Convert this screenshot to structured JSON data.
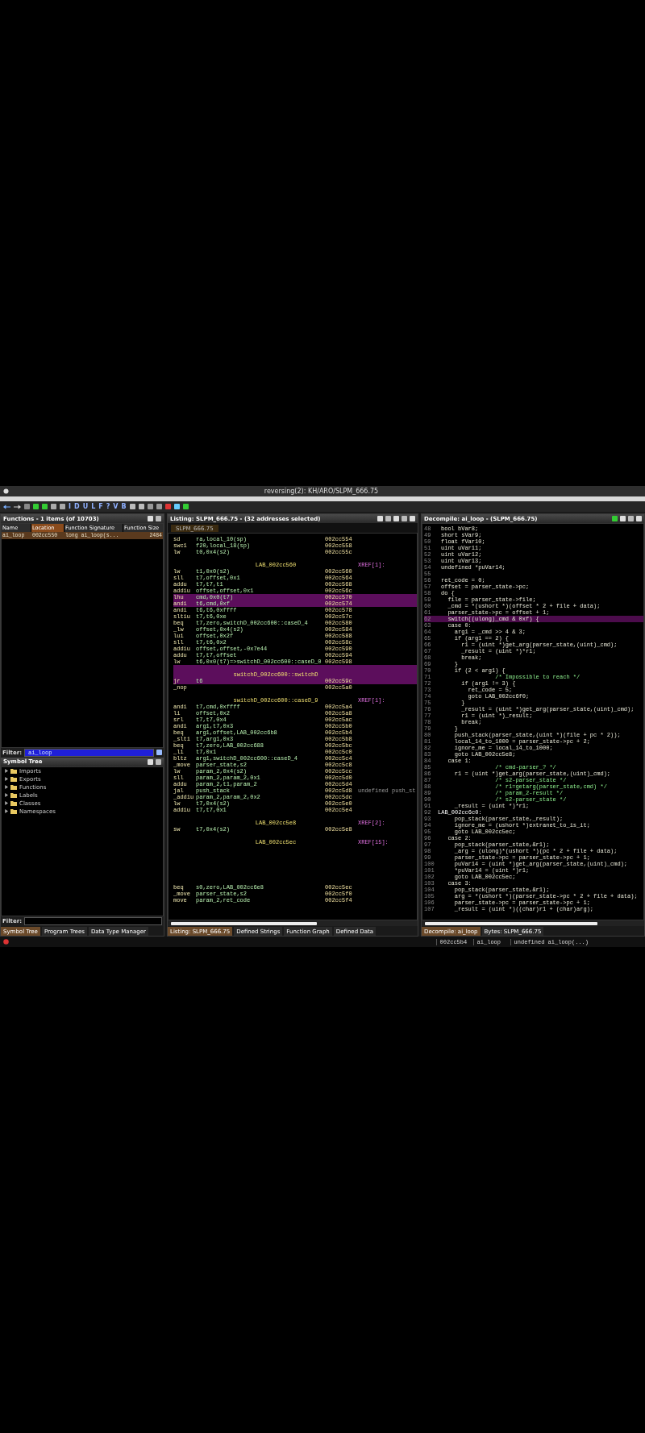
{
  "window": {
    "title": "reversing(2): KH/ARO/SLPM_666.75"
  },
  "toolbar": {
    "letters": [
      "I",
      "D",
      "U",
      "L",
      "F",
      "?",
      "V",
      "B"
    ]
  },
  "functions": {
    "title": "Functions - 1 items (of 10703)",
    "columns": [
      {
        "label": "Name",
        "sorted": false
      },
      {
        "label": "Location",
        "sorted": true
      },
      {
        "label": "Function Signature",
        "sorted": false
      },
      {
        "label": "Function Size",
        "sorted": false
      }
    ],
    "rows": [
      {
        "cells": [
          "ai_loop",
          "002cc550",
          "long ai_loop(s...",
          "2484"
        ],
        "selected": true
      }
    ],
    "filter_label": "Filter:",
    "filter": "ai_loop"
  },
  "symbol_tree": {
    "title": "Symbol Tree",
    "items": [
      {
        "label": "Imports",
        "expanded": false
      },
      {
        "label": "Exports",
        "expanded": false
      },
      {
        "label": "Functions",
        "expanded": false
      },
      {
        "label": "Labels",
        "expanded": false
      },
      {
        "label": "Classes",
        "expanded": false
      },
      {
        "label": "Namespaces",
        "expanded": false
      }
    ],
    "filter_label": "Filter:"
  },
  "left_tabs": [
    {
      "label": "Symbol Tree",
      "selected": true
    },
    {
      "label": "Program Trees",
      "selected": false
    },
    {
      "label": "Data Type Manager",
      "selected": false
    }
  ],
  "listing": {
    "title": "Listing:  SLPM_666.75 - (32 addresses selected)",
    "tab": "SLPM_666.75",
    "rows": [
      {
        "kind": "instr",
        "mnemonic": "sd",
        "operands": "ra,local_10(sp)",
        "address": "002cc554",
        "selected": false
      },
      {
        "kind": "instr",
        "mnemonic": "swc1",
        "operands": "f20,local_18(sp)",
        "address": "002cc558",
        "selected": false
      },
      {
        "kind": "instr",
        "mnemonic": "lw",
        "operands": "t0,0x4(s2)",
        "address": "002cc55c",
        "selected": false
      },
      {
        "kind": "blank",
        "selected": false
      },
      {
        "kind": "label",
        "label": "LAB_002cc560",
        "xref": "XREF[1]:",
        "selected": false
      },
      {
        "kind": "instr",
        "mnemonic": "lw",
        "operands": "t1,0x0(s2)",
        "address": "002cc560",
        "selected": false
      },
      {
        "kind": "instr",
        "mnemonic": "sll",
        "operands": "t7,offset,0x1",
        "address": "002cc564",
        "selected": false
      },
      {
        "kind": "instr",
        "mnemonic": "addu",
        "operands": "t7,t7,t1",
        "address": "002cc568",
        "selected": false
      },
      {
        "kind": "instr",
        "mnemonic": "addiu",
        "operands": "offset,offset,0x1",
        "address": "002cc56c",
        "selected": false
      },
      {
        "kind": "instr",
        "mnemonic": "lhu",
        "operands": "cmd,0x0(t7)",
        "address": "002cc570",
        "selected": true
      },
      {
        "kind": "instr",
        "mnemonic": "andi",
        "operands": "t6,cmd,0xf",
        "address": "002cc574",
        "selected": true
      },
      {
        "kind": "instr",
        "mnemonic": "andi",
        "operands": "t6,t6,0xffff",
        "address": "002cc578",
        "selected": false
      },
      {
        "kind": "instr",
        "mnemonic": "sltiu",
        "operands": "t7,t6,0xe",
        "address": "002cc57c",
        "selected": false
      },
      {
        "kind": "instr",
        "mnemonic": "beq",
        "operands": "t7,zero,switchD_002cc600::caseD_4",
        "address": "002cc580",
        "selected": false
      },
      {
        "kind": "instr",
        "mnemonic": "_lw",
        "operands": "offset,0x4(s2)",
        "address": "002cc584",
        "selected": false
      },
      {
        "kind": "instr",
        "mnemonic": "lui",
        "operands": "offset,0x2f",
        "address": "002cc588",
        "selected": false
      },
      {
        "kind": "instr",
        "mnemonic": "sll",
        "operands": "t7,t6,0x2",
        "address": "002cc58c",
        "selected": false
      },
      {
        "kind": "instr",
        "mnemonic": "addiu",
        "operands": "offset,offset,-0x7e44",
        "address": "002cc590",
        "selected": false
      },
      {
        "kind": "instr",
        "mnemonic": "addu",
        "operands": "t7,t7,offset",
        "address": "002cc594",
        "selected": false
      },
      {
        "kind": "instr",
        "mnemonic": "lw",
        "operands": "t6,0x0(t7)=>switchD_002cc600::caseD_0",
        "address": "002cc598",
        "selected": false
      },
      {
        "kind": "blank",
        "selected": true
      },
      {
        "kind": "label",
        "label": "switchD_002cc600::switchD",
        "selected": true
      },
      {
        "kind": "instr",
        "mnemonic": "jr",
        "operands": "t6",
        "address": "002cc59c",
        "selected": true
      },
      {
        "kind": "instr",
        "mnemonic": "_nop",
        "operands": "",
        "address": "002cc5a0",
        "selected": false
      },
      {
        "kind": "blank",
        "selected": false
      },
      {
        "kind": "label",
        "label": "switchD_002cc600::caseD_9",
        "xref": "XREF[1]:",
        "selected": false
      },
      {
        "kind": "instr",
        "mnemonic": "andi",
        "operands": "t7,cmd,0xffff",
        "address": "002cc5a4",
        "selected": false
      },
      {
        "kind": "instr",
        "mnemonic": "li",
        "operands": "offset,0x2",
        "address": "002cc5a8",
        "selected": false
      },
      {
        "kind": "instr",
        "mnemonic": "srl",
        "operands": "t7,t7,0x4",
        "address": "002cc5ac",
        "selected": false
      },
      {
        "kind": "instr",
        "mnemonic": "andi",
        "operands": "arg1,t7,0x3",
        "address": "002cc5b0",
        "selected": false
      },
      {
        "kind": "instr",
        "mnemonic": "beq",
        "operands": "arg1,offset,LAB_002cc6b8",
        "address": "002cc5b4",
        "selected": false
      },
      {
        "kind": "instr",
        "mnemonic": "_slti",
        "operands": "t7,arg1,0x3",
        "address": "002cc5b8",
        "selected": false
      },
      {
        "kind": "instr",
        "mnemonic": "beq",
        "operands": "t7,zero,LAB_002cc688",
        "address": "002cc5bc",
        "selected": false
      },
      {
        "kind": "instr",
        "mnemonic": "_li",
        "operands": "t7,0x1",
        "address": "002cc5c0",
        "selected": false
      },
      {
        "kind": "instr",
        "mnemonic": "bltz",
        "operands": "arg1,switchD_002cc600::caseD_4",
        "address": "002cc5c4",
        "selected": false
      },
      {
        "kind": "instr",
        "mnemonic": "_move",
        "operands": "parser_state,s2",
        "address": "002cc5c8",
        "selected": false
      },
      {
        "kind": "instr",
        "mnemonic": "lw",
        "operands": "param_2,0x4(s2)",
        "address": "002cc5cc",
        "selected": false
      },
      {
        "kind": "instr",
        "mnemonic": "sll",
        "operands": "param_2,param_2,0x1",
        "address": "002cc5d0",
        "selected": false
      },
      {
        "kind": "instr",
        "mnemonic": "addu",
        "operands": "param_2,t1,param_2",
        "address": "002cc5d4",
        "selected": false
      },
      {
        "kind": "instr",
        "mnemonic": "jal",
        "operands": "push_stack",
        "address": "002cc5d8",
        "comment": "undefined push_st",
        "selected": false
      },
      {
        "kind": "instr",
        "mnemonic": "_addiu",
        "operands": "param_2,param_2,0x2",
        "address": "002cc5dc",
        "selected": false
      },
      {
        "kind": "instr",
        "mnemonic": "lw",
        "operands": "t7,0x4(s2)",
        "address": "002cc5e0",
        "selected": false
      },
      {
        "kind": "instr",
        "mnemonic": "addiu",
        "operands": "t7,t7,0x1",
        "address": "002cc5e4",
        "selected": false
      },
      {
        "kind": "blank",
        "selected": false
      },
      {
        "kind": "label",
        "label": "LAB_002cc5e8",
        "xref": "XREF[2]:",
        "selected": false
      },
      {
        "kind": "instr",
        "mnemonic": "sw",
        "operands": "t7,0x4(s2)",
        "address": "002cc5e8",
        "selected": false
      },
      {
        "kind": "blank",
        "selected": false
      },
      {
        "kind": "label",
        "label": "LAB_002cc5ec",
        "xref": "XREF[15]:",
        "selected": false
      },
      {
        "kind": "blank",
        "selected": false
      },
      {
        "kind": "blank",
        "selected": false
      },
      {
        "kind": "blank",
        "selected": false
      },
      {
        "kind": "blank",
        "selected": false
      },
      {
        "kind": "blank",
        "selected": false
      },
      {
        "kind": "blank",
        "selected": false
      },
      {
        "kind": "instr",
        "mnemonic": "beq",
        "operands": "s0,zero,LAB_002cc6e8",
        "address": "002cc5ec",
        "selected": false
      },
      {
        "kind": "instr",
        "mnemonic": "_move",
        "operands": "parser_state,s2",
        "address": "002cc5f0",
        "selected": false
      },
      {
        "kind": "instr",
        "mnemonic": "move",
        "operands": "param_2,ret_code",
        "address": "002cc5f4",
        "selected": false
      }
    ]
  },
  "listing_tabs": [
    {
      "label": "Listing:  SLPM_666.75",
      "selected": true
    },
    {
      "label": "Defined Strings",
      "selected": false
    },
    {
      "label": "Function Graph",
      "selected": false
    },
    {
      "label": "Defined Data",
      "selected": false
    }
  ],
  "decompile": {
    "title": "Decompile: ai_loop - (SLPM_666.75)",
    "lines": [
      {
        "number": "48",
        "kind": "code",
        "text": "bool bVar8;",
        "selected": false
      },
      {
        "number": "49",
        "kind": "code",
        "text": "short sVar9;",
        "selected": false
      },
      {
        "number": "50",
        "kind": "code",
        "text": "float fVar10;",
        "selected": false
      },
      {
        "number": "51",
        "kind": "code",
        "text": "uint uVar11;",
        "selected": false
      },
      {
        "number": "52",
        "kind": "code",
        "text": "uint uVar12;",
        "selected": false
      },
      {
        "number": "53",
        "kind": "code",
        "text": "uint uVar13;",
        "selected": false
      },
      {
        "number": "54",
        "kind": "code",
        "text": "undefined *puVar14;",
        "selected": false
      },
      {
        "number": "55",
        "kind": "blank",
        "selected": false
      },
      {
        "number": "56",
        "kind": "code",
        "text": "ret_code = 0;",
        "selected": false
      },
      {
        "number": "57",
        "kind": "code",
        "text": "offset = parser_state->pc;",
        "selected": false
      },
      {
        "number": "58",
        "kind": "code",
        "text": "do {",
        "selected": false
      },
      {
        "number": "59",
        "kind": "code",
        "text": "  file = parser_state->file;",
        "selected": false
      },
      {
        "number": "60",
        "kind": "code",
        "text": "  _cmd = *(ushort *)(offset * 2 + file + data);",
        "selected": false
      },
      {
        "number": "61",
        "kind": "code",
        "text": "  parser_state->pc = offset + 1;",
        "selected": false
      },
      {
        "number": "62",
        "kind": "code",
        "text": "  switch((ulong)_cmd & 0xf) {",
        "selected": true
      },
      {
        "number": "63",
        "kind": "code",
        "text": "  case 0:",
        "selected": false
      },
      {
        "number": "64",
        "kind": "code",
        "text": "    arg1 = _cmd >> 4 & 3;",
        "selected": false
      },
      {
        "number": "65",
        "kind": "code",
        "text": "    if (arg1 == 2) {",
        "selected": false
      },
      {
        "number": "66",
        "kind": "code",
        "text": "      r1 = (uint *)get_arg(parser_state,(uint)_cmd);",
        "selected": false
      },
      {
        "number": "67",
        "kind": "code",
        "text": "      _result = (uint *)*r1;",
        "selected": false
      },
      {
        "number": "68",
        "kind": "code",
        "text": "      break;",
        "selected": false
      },
      {
        "number": "69",
        "kind": "code",
        "text": "    }",
        "selected": false
      },
      {
        "number": "70",
        "kind": "code",
        "text": "    if (2 < arg1) {",
        "selected": false
      },
      {
        "number": "71",
        "kind": "comment",
        "text": "                /* Impossible to reach */",
        "selected": false
      },
      {
        "number": "72",
        "kind": "code",
        "text": "      if (arg1 != 3) {",
        "selected": false
      },
      {
        "number": "73",
        "kind": "code",
        "text": "        ret_code = 5;",
        "selected": false
      },
      {
        "number": "74",
        "kind": "code",
        "text": "        goto LAB_002cc6f0;",
        "selected": false
      },
      {
        "number": "75",
        "kind": "code",
        "text": "      }",
        "selected": false
      },
      {
        "number": "76",
        "kind": "code",
        "text": "      _result = (uint *)get_arg(parser_state,(uint)_cmd);",
        "selected": false
      },
      {
        "number": "77",
        "kind": "code",
        "text": "      r1 = (uint *)_result;",
        "selected": false
      },
      {
        "number": "78",
        "kind": "code",
        "text": "      break;",
        "selected": false
      },
      {
        "number": "79",
        "kind": "code",
        "text": "    }",
        "selected": false
      },
      {
        "number": "80",
        "kind": "code",
        "text": "    push_stack(parser_state,(uint *)(file + pc * 2));",
        "selected": false
      },
      {
        "number": "81",
        "kind": "code",
        "text": "    local_14_to_1000 = parser_state->pc + 2;",
        "selected": false
      },
      {
        "number": "82",
        "kind": "code",
        "text": "    ignore_me = local_14_to_1000;",
        "selected": false
      },
      {
        "number": "83",
        "kind": "code",
        "text": "    goto LAB_002cc5e8;",
        "selected": false
      },
      {
        "number": "84",
        "kind": "code",
        "text": "  case 1:",
        "selected": false
      },
      {
        "number": "85",
        "kind": "comment",
        "text": "                /* cmd-parser_? */",
        "selected": false
      },
      {
        "number": "86",
        "kind": "code",
        "text": "    r1 = (uint *)get_arg(parser_state,(uint)_cmd);",
        "selected": false
      },
      {
        "number": "87",
        "kind": "comment",
        "text": "                /* s2-parser_state */",
        "selected": false
      },
      {
        "number": "88",
        "kind": "comment",
        "text": "                /* r1=getarg(parser_state,cmd) */",
        "selected": false
      },
      {
        "number": "89",
        "kind": "comment",
        "text": "                /* param_2-result */",
        "selected": false
      },
      {
        "number": "90",
        "kind": "comment",
        "text": "                /* s2-parser_state */",
        "selected": false
      },
      {
        "number": "91",
        "kind": "code",
        "text": "    _result = (uint *)*r1;",
        "selected": false
      },
      {
        "number": "92",
        "kind": "label",
        "text": "LAB_002cc6c0:",
        "selected": false
      },
      {
        "number": "93",
        "kind": "code",
        "text": "    pop_stack(parser_state,_result);",
        "selected": false
      },
      {
        "number": "94",
        "kind": "code",
        "text": "    ignore_me = (ushort *)extranet_to_is_it;",
        "selected": false
      },
      {
        "number": "95",
        "kind": "code",
        "text": "    goto LAB_002cc5ec;",
        "selected": false
      },
      {
        "number": "96",
        "kind": "code",
        "text": "  case 2:",
        "selected": false
      },
      {
        "number": "97",
        "kind": "code",
        "text": "    pop_stack(parser_state,&r1);",
        "selected": false
      },
      {
        "number": "98",
        "kind": "code",
        "text": "    _arg = (ulong)*(ushort *)(pc * 2 + file + data);",
        "selected": false
      },
      {
        "number": "99",
        "kind": "code",
        "text": "    parser_state->pc = parser_state->pc + 1;",
        "selected": false
      },
      {
        "number": "100",
        "kind": "code",
        "text": "    puVar14 = (uint *)get_arg(parser_state,(uint)_cmd);",
        "selected": false
      },
      {
        "number": "101",
        "kind": "code",
        "text": "    *puVar14 = (uint *)r1;",
        "selected": false
      },
      {
        "number": "102",
        "kind": "code",
        "text": "    goto LAB_002cc5ec;",
        "selected": false
      },
      {
        "number": "103",
        "kind": "code",
        "text": "  case 3:",
        "selected": false
      },
      {
        "number": "104",
        "kind": "code",
        "text": "    pop_stack(parser_state,&r1);",
        "selected": false
      },
      {
        "number": "105",
        "kind": "code",
        "text": "    arg = *(ushort *)(parser_state->pc * 2 + file + data);",
        "selected": false
      },
      {
        "number": "106",
        "kind": "code",
        "text": "    parser_state->pc = parser_state->pc + 1;",
        "selected": false
      },
      {
        "number": "107",
        "kind": "code",
        "text": "    _result = (uint *)((char)r1 + (char)arg);",
        "selected": false
      }
    ]
  },
  "decompile_tabs": [
    {
      "label": "Decompile: ai_loop",
      "selected": true
    },
    {
      "label": "Bytes: SLPM_666.75",
      "selected": false
    }
  ],
  "status_bar": {
    "cells": [
      "002cc5b4",
      "ai_loop",
      "undefined ai_loop(...)"
    ]
  }
}
